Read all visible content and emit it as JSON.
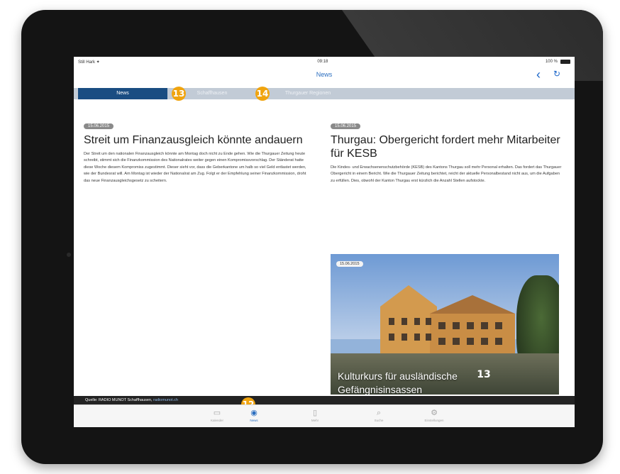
{
  "status": {
    "carrier": "Still Hark ✦",
    "time": "09:18",
    "battery": "100 %"
  },
  "nav": {
    "title": "News",
    "back_icon": "chevron-left-icon",
    "refresh_icon": "refresh-icon"
  },
  "tabs": [
    {
      "label": "News",
      "active": true
    },
    {
      "label": "Schaffhausen",
      "active": false
    },
    {
      "label": "Thurgauer Regionen",
      "active": false
    }
  ],
  "callouts": {
    "tab_second": "13",
    "tab_third": "14",
    "source": "12",
    "feature": "13"
  },
  "articles": [
    {
      "date": "15.06.2015",
      "headline": "Streit um Finanzausgleich könnte andauern",
      "body": "Der Streit um den nationalen Finanzausgleich könnte am Montag doch nicht zu Ende gehen. Wie die Thurgauer Zeitung heute schreibt, stimmt sich die Finanzkommission des Nationalrates weiter gegen einen Kompromissvorschlag. Der Ständerat hatte diese Woche diesem Kompromiss zugestimmt. Dieser sieht vor, dass die Geberkantone um halb so viel Geld entlastet werden, wie der Bundesrat will. Am Montag ist wieder der Nationalrat am Zug. Folgt er der Empfehlung seiner Finanzkommission, droht das neue Finanzausgleichsgesetz zu scheitern."
    },
    {
      "date": "15.06.2015",
      "headline": "Thurgau: Obergericht fordert mehr Mitarbeiter für KESB",
      "body": "Die Kindes- und Erwachsenenschutzbehörde (KESB) des Kantons Thurgau soll mehr Personal erhalten. Das fordert das Thurgauer Obergericht in einem Bericht. Wie die Thurgauer Zeitung berichtet, reicht der aktuelle Personalbestand nicht aus, um die Aufgaben zu erfüllen. Dies, obwohl der Kanton Thurgau erst kürzlich die Anzahl Stellen aufstockte."
    }
  ],
  "feature": {
    "date": "15.06.2015",
    "caption_line1": "Kulturkurs für ausländische",
    "caption_line2": "Gefängnisinsassen"
  },
  "source": {
    "prefix": "Quelle: RADIO MUNOT Schaffhausen, ",
    "link": "radiomunot.ch"
  },
  "bottom_tabs": [
    {
      "label": "Kalender",
      "icon": "calendar-icon",
      "active": false
    },
    {
      "label": "News",
      "icon": "news-icon",
      "active": true
    },
    {
      "label": "Mehr",
      "icon": "book-icon",
      "active": false
    },
    {
      "label": "Suche",
      "icon": "search-icon",
      "active": false
    },
    {
      "label": "Einstellungen",
      "icon": "gear-icon",
      "active": false
    }
  ]
}
